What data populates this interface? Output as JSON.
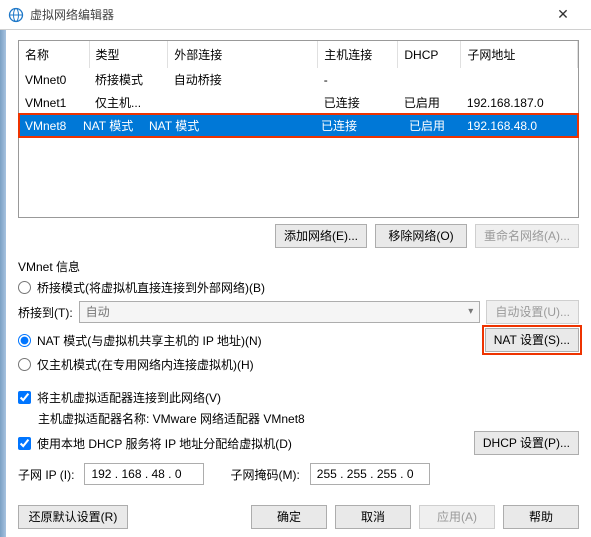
{
  "window": {
    "title": "虚拟网络编辑器"
  },
  "table": {
    "headers": [
      "名称",
      "类型",
      "外部连接",
      "主机连接",
      "DHCP",
      "子网地址"
    ],
    "rows": [
      {
        "name": "VMnet0",
        "type": "桥接模式",
        "ext": "自动桥接",
        "host": "-",
        "dhcp": "",
        "subnet": ""
      },
      {
        "name": "VMnet1",
        "type": "仅主机...",
        "ext": "",
        "host": "已连接",
        "dhcp": "已启用",
        "subnet": "192.168.187.0"
      },
      {
        "name": "VMnet8",
        "type": "NAT 模式",
        "ext": "NAT 模式",
        "host": "已连接",
        "dhcp": "已启用",
        "subnet": "192.168.48.0"
      }
    ]
  },
  "buttons": {
    "add_net": "添加网络(E)...",
    "remove_net": "移除网络(O)",
    "rename_net": "重命名网络(A)..."
  },
  "info": {
    "label": "VMnet 信息",
    "bridge_radio": "桥接模式(将虚拟机直接连接到外部网络)(B)",
    "bridge_to_label": "桥接到(T):",
    "bridge_to_value": "自动",
    "auto_config": "自动设置(U)...",
    "nat_radio": "NAT 模式(与虚拟机共享主机的 IP 地址)(N)",
    "nat_settings": "NAT 设置(S)...",
    "hostonly_radio": "仅主机模式(在专用网络内连接虚拟机)(H)",
    "connect_host": "将主机虚拟适配器连接到此网络(V)",
    "adapter_label": "主机虚拟适配器名称: VMware 网络适配器 VMnet8",
    "dhcp_check": "使用本地 DHCP 服务将 IP 地址分配给虚拟机(D)",
    "dhcp_settings": "DHCP 设置(P)...",
    "subnet_ip_label": "子网 IP (I):",
    "subnet_ip_value": "192 . 168 . 48 . 0",
    "subnet_mask_label": "子网掩码(M):",
    "subnet_mask_value": "255 . 255 . 255 . 0"
  },
  "footer": {
    "restore": "还原默认设置(R)",
    "ok": "确定",
    "cancel": "取消",
    "apply": "应用(A)",
    "help": "帮助"
  }
}
